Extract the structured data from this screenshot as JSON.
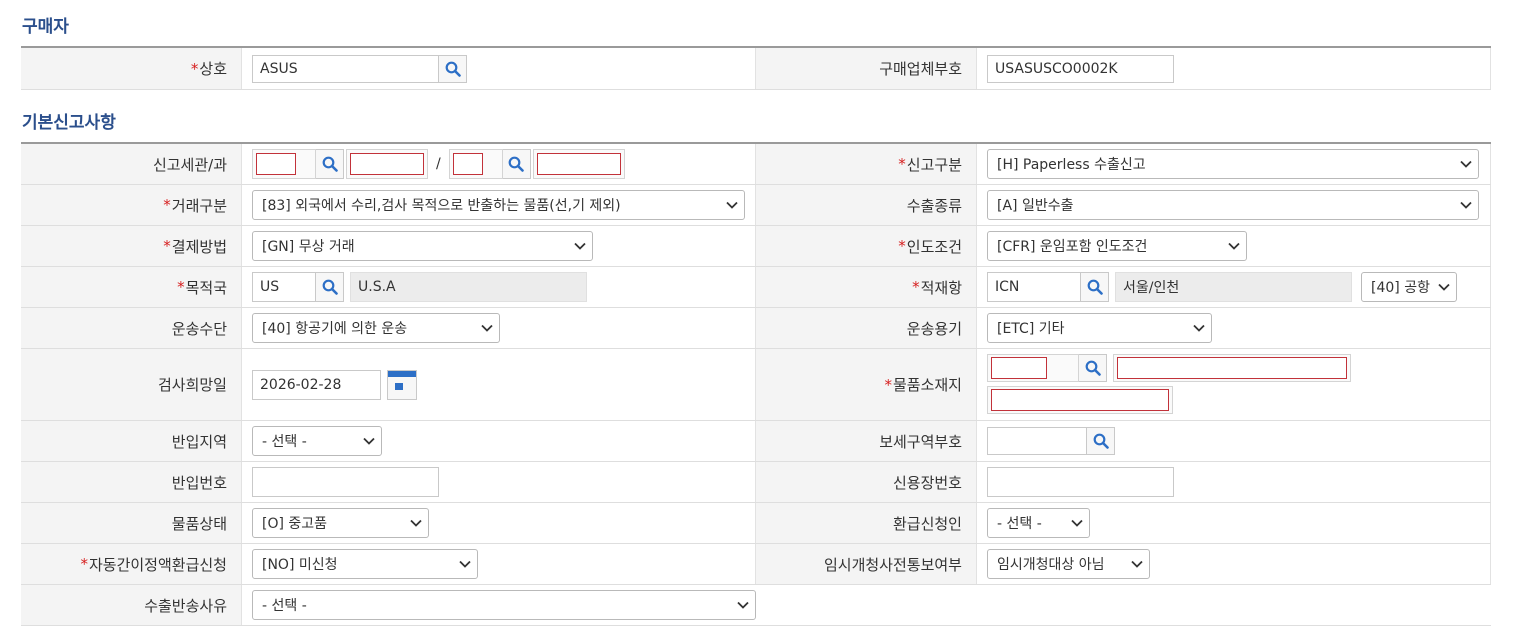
{
  "buyer_section": {
    "title": "구매자",
    "trade_name": {
      "label": "상호",
      "required": "*",
      "value": "ASUS"
    },
    "buyer_code": {
      "label": "구매업체부호",
      "value": "USASUSCO0002K"
    }
  },
  "basic_section": {
    "title": "기본신고사항",
    "customs": {
      "label": "신고세관/과",
      "separator": "/"
    },
    "declaration_type": {
      "label": "신고구분",
      "required": "*",
      "value": "[H] Paperless 수출신고"
    },
    "transaction_type": {
      "label": "거래구분",
      "required": "*",
      "value": "[83] 외국에서 수리,검사 목적으로 반출하는 물품(선,기 제외)"
    },
    "export_type": {
      "label": "수출종류",
      "value": "[A] 일반수출"
    },
    "payment_method": {
      "label": "결제방법",
      "required": "*",
      "value": "[GN] 무상 거래"
    },
    "delivery_terms": {
      "label": "인도조건",
      "required": "*",
      "value": "[CFR] 운임포함 인도조건"
    },
    "destination": {
      "label": "목적국",
      "required": "*",
      "code": "US",
      "name": "U.S.A"
    },
    "loading_port": {
      "label": "적재항",
      "required": "*",
      "code": "ICN",
      "name": "서울/인천",
      "type": "[40] 공항"
    },
    "transport_means": {
      "label": "운송수단",
      "value": "[40] 항공기에 의한 운송"
    },
    "transport_container": {
      "label": "운송용기",
      "value": "[ETC] 기타"
    },
    "inspection_date": {
      "label": "검사희망일",
      "value": "2026-02-28"
    },
    "goods_location": {
      "label": "물품소재지",
      "required": "*"
    },
    "entry_area": {
      "label": "반입지역",
      "value": "- 선택 -"
    },
    "bonded_area_code": {
      "label": "보세구역부호"
    },
    "entry_number": {
      "label": "반입번호"
    },
    "lc_number": {
      "label": "신용장번호"
    },
    "goods_condition": {
      "label": "물품상태",
      "value": "[O] 중고품"
    },
    "refund_applicant": {
      "label": "환급신청인",
      "value": "- 선택 -"
    },
    "auto_refund": {
      "label": "자동간이정액환급신청",
      "required": "*",
      "value": "[NO] 미신청"
    },
    "temp_opening": {
      "label": "임시개청사전통보여부",
      "value": "임시개청대상 아님"
    },
    "return_reason": {
      "label": "수출반송사유",
      "value": "- 선택 -"
    }
  },
  "colors": {
    "accent": "#2b4f8c",
    "required": "#d61f1f",
    "error_border": "#c2323a",
    "icon": "#2d6fc6"
  }
}
